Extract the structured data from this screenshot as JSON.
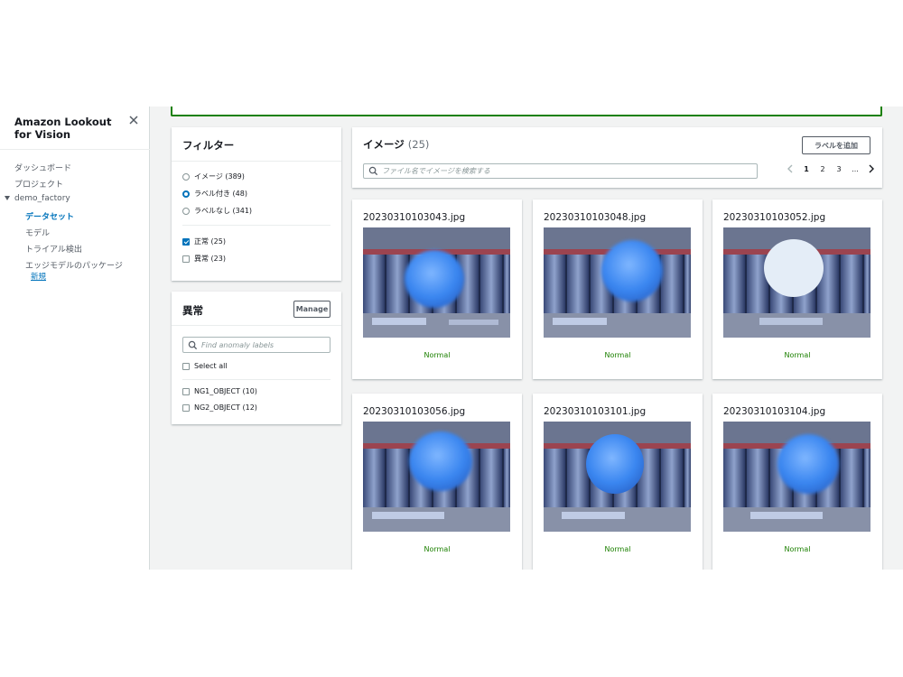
{
  "sidebar": {
    "title": "Amazon Lookout for Vision",
    "items": [
      "ダッシュボード",
      "プロジェクト"
    ],
    "project": "demo_factory",
    "sub_items": [
      "データセット",
      "モデル",
      "トライアル検出",
      "エッジモデルのパッケージ"
    ],
    "badge": "新規"
  },
  "filter": {
    "title": "フィルター",
    "radios": [
      "イメージ (389)",
      "ラベル付き (48)",
      "ラベルなし (341)"
    ],
    "checks": [
      "正常 (25)",
      "異常 (23)"
    ]
  },
  "anomaly": {
    "title": "異常",
    "manage": "Manage",
    "search_placeholder": "Find anomaly labels",
    "select_all": "Select all",
    "labels": [
      "NG1_OBJECT (10)",
      "NG2_OBJECT (12)"
    ]
  },
  "images": {
    "title": "イメージ",
    "count": "(25)",
    "add_label": "ラベルを追加",
    "search_placeholder": "ファイル名でイメージを検索する",
    "pages": [
      "1",
      "2",
      "3",
      "..."
    ],
    "cards": [
      {
        "name": "20230310103043.jpg",
        "status": "Normal"
      },
      {
        "name": "20230310103048.jpg",
        "status": "Normal"
      },
      {
        "name": "20230310103052.jpg",
        "status": "Normal"
      },
      {
        "name": "20230310103056.jpg",
        "status": "Normal"
      },
      {
        "name": "20230310103101.jpg",
        "status": "Normal"
      },
      {
        "name": "20230310103104.jpg",
        "status": "Normal"
      }
    ]
  },
  "colors": {
    "accent": "#0073bb",
    "success": "#1d8102",
    "page_bg": "#f2f3f3"
  }
}
